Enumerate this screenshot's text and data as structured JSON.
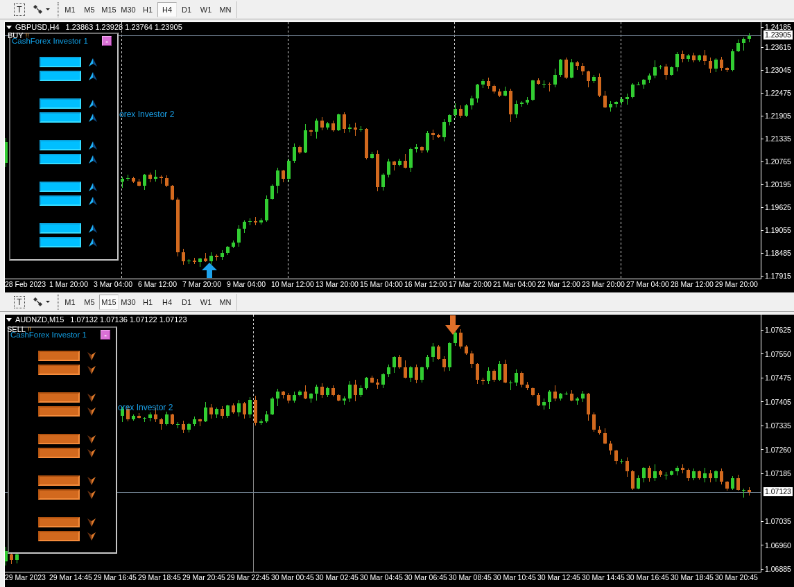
{
  "windows": [
    {
      "toolbar": {
        "tools": [
          {
            "kind": "glyph",
            "glyph": "T"
          },
          {
            "kind": "shapes"
          }
        ],
        "timeframes": [
          {
            "label": "M1",
            "selected": false
          },
          {
            "label": "M5",
            "selected": false
          },
          {
            "label": "M15",
            "selected": false
          },
          {
            "label": "M30",
            "selected": false
          },
          {
            "label": "H1",
            "selected": false
          },
          {
            "label": "H4",
            "selected": true
          },
          {
            "label": "D1",
            "selected": false
          },
          {
            "label": "W1",
            "selected": false
          },
          {
            "label": "MN",
            "selected": false
          }
        ]
      },
      "chart": {
        "symbol": "GBPUSD,H4",
        "ohlc": "1.23863 1.23928 1.23764 1.23905",
        "signal": {
          "kind": "buy",
          "label": "BUY",
          "mark": "!!"
        },
        "panel": {
          "title": "CashForex Investor 1",
          "minimize": "-",
          "groups": [
            {
              "tiles": [
                {
                  "kind": "buy"
                },
                {
                  "kind": "buy"
                }
              ]
            },
            {
              "tiles": [
                {
                  "kind": "buy"
                },
                {
                  "kind": "buy"
                }
              ]
            },
            {
              "tiles": [
                {
                  "kind": "buy"
                },
                {
                  "kind": "buy"
                }
              ]
            },
            {
              "tiles": [
                {
                  "kind": "buy"
                },
                {
                  "kind": "buy"
                }
              ]
            },
            {
              "tiles": [
                {
                  "kind": "buy"
                },
                {
                  "kind": "buy"
                }
              ]
            }
          ]
        },
        "partial_title": "orex Investor 2",
        "price_axis": {
          "labels": [
            "1.24185",
            "1.23615",
            "1.23045",
            "1.22475",
            "1.21905",
            "1.21335",
            "1.20765",
            "1.20195",
            "1.19625",
            "1.19055",
            "1.18485",
            "1.17915"
          ],
          "current": "1.23905"
        },
        "time_axis": {
          "labels": [
            "28 Feb 2023",
            "1 Mar 20:00",
            "3 Mar 04:00",
            "6 Mar 12:00",
            "7 Mar 20:00",
            "9 Mar 04:00",
            "10 Mar 12:00",
            "13 Mar 20:00",
            "15 Mar 04:00",
            "16 Mar 12:00",
            "17 Mar 20:00",
            "21 Mar 04:00",
            "22 Mar 12:00",
            "23 Mar 20:00",
            "27 Mar 04:00",
            "28 Mar 12:00",
            "29 Mar 20:00"
          ]
        }
      }
    },
    {
      "toolbar": {
        "tools": [
          {
            "kind": "glyph",
            "glyph": "T"
          },
          {
            "kind": "shapes"
          }
        ],
        "timeframes": [
          {
            "label": "M1",
            "selected": false
          },
          {
            "label": "M5",
            "selected": false
          },
          {
            "label": "M15",
            "selected": true
          },
          {
            "label": "M30",
            "selected": false
          },
          {
            "label": "H1",
            "selected": false
          },
          {
            "label": "H4",
            "selected": false
          },
          {
            "label": "D1",
            "selected": false
          },
          {
            "label": "W1",
            "selected": false
          },
          {
            "label": "MN",
            "selected": false
          }
        ]
      },
      "chart": {
        "symbol": "AUDNZD,M15",
        "ohlc": "1.07132 1.07136 1.07122 1.07123",
        "signal": {
          "kind": "sell",
          "label": "SELL",
          "mark": "!!"
        },
        "panel": {
          "title": "CashForex Investor 1",
          "minimize": "-",
          "groups": [
            {
              "tiles": [
                {
                  "kind": "sell"
                },
                {
                  "kind": "sell"
                }
              ]
            },
            {
              "tiles": [
                {
                  "kind": "sell"
                },
                {
                  "kind": "sell"
                }
              ]
            },
            {
              "tiles": [
                {
                  "kind": "sell"
                },
                {
                  "kind": "sell"
                }
              ]
            },
            {
              "tiles": [
                {
                  "kind": "sell"
                },
                {
                  "kind": "sell"
                }
              ]
            },
            {
              "tiles": [
                {
                  "kind": "sell"
                },
                {
                  "kind": "sell"
                }
              ]
            }
          ]
        },
        "partial_title": "orex Investor 2",
        "price_axis": {
          "labels": [
            "1.07625",
            "1.07550",
            "1.07475",
            "1.07405",
            "1.07335",
            "1.07260",
            "1.07185",
            "1.07035",
            "1.06960",
            "1.06885"
          ],
          "current": "1.07123"
        },
        "time_axis": {
          "labels": [
            "29 Mar 2023",
            "29 Mar 14:45",
            "29 Mar 16:45",
            "29 Mar 18:45",
            "29 Mar 20:45",
            "29 Mar 22:45",
            "30 Mar 00:45",
            "30 Mar 02:45",
            "30 Mar 04:45",
            "30 Mar 06:45",
            "30 Mar 08:45",
            "30 Mar 10:45",
            "30 Mar 12:45",
            "30 Mar 14:45",
            "30 Mar 16:45",
            "30 Mar 18:45",
            "30 Mar 20:45"
          ]
        }
      }
    }
  ]
}
